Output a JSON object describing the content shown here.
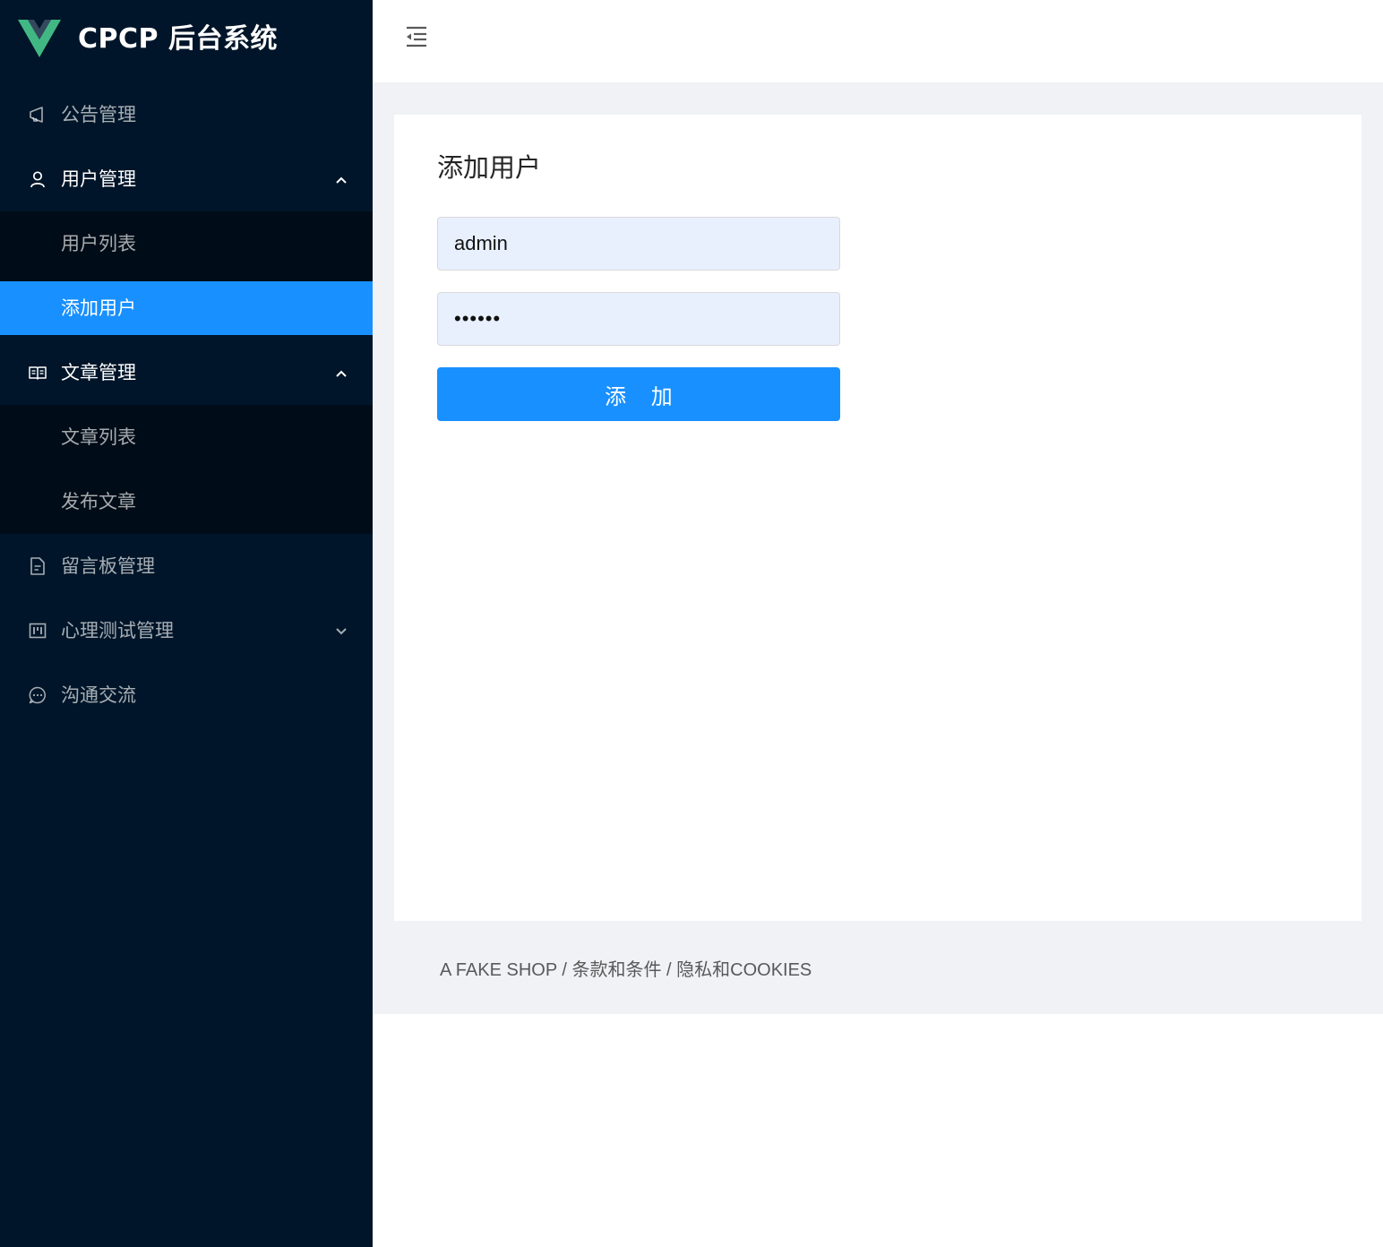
{
  "app": {
    "title": "CPCP 后台系统"
  },
  "colors": {
    "sider_bg": "#001529",
    "submenu_bg": "#000c17",
    "primary": "#1890ff",
    "content_bg": "#f0f2f5"
  },
  "sidebar": {
    "items": [
      {
        "label": "公告管理",
        "icon": "megaphone-icon"
      },
      {
        "label": "用户管理",
        "icon": "user-icon",
        "expanded": true,
        "children": [
          {
            "label": "用户列表"
          },
          {
            "label": "添加用户",
            "selected": true
          }
        ]
      },
      {
        "label": "文章管理",
        "icon": "book-icon",
        "expanded": true,
        "children": [
          {
            "label": "文章列表"
          },
          {
            "label": "发布文章"
          }
        ]
      },
      {
        "label": "留言板管理",
        "icon": "file-icon"
      },
      {
        "label": "心理测试管理",
        "icon": "project-icon",
        "expanded": false
      },
      {
        "label": "沟通交流",
        "icon": "message-icon"
      }
    ]
  },
  "header": {
    "fold_icon": "menu-fold-icon"
  },
  "form": {
    "title": "添加用户",
    "username_value": "admin",
    "password_value": "••••••",
    "submit_label": "添 加"
  },
  "footer": {
    "text": "A FAKE SHOP / 条款和条件 / 隐私和COOKIES"
  }
}
